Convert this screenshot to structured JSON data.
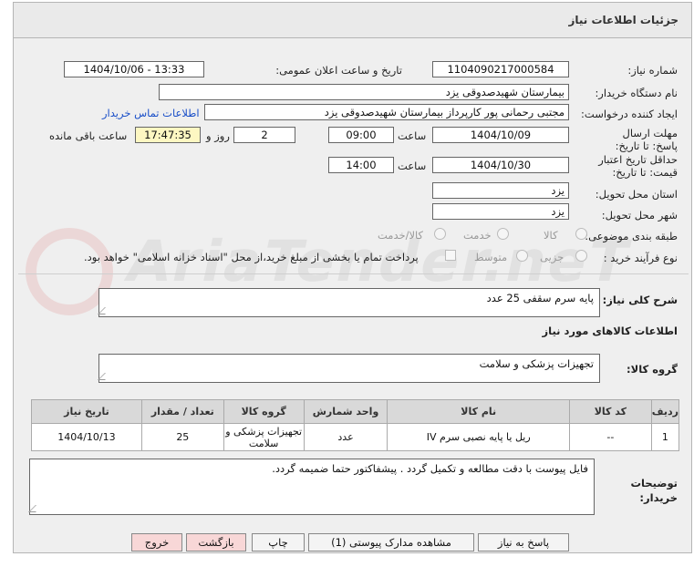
{
  "header": {
    "title": "جزئیات اطلاعات نیاز"
  },
  "fields": {
    "need_number_label": "شماره نیاز:",
    "need_number": "1104090217000584",
    "announce_label": "تاریخ و ساعت اعلان عمومی:",
    "announce_value": "1404/10/06 - 13:33",
    "buyer_label": "نام دستگاه خریدار:",
    "buyer_value": "بیمارستان شهیدصدوقی یزد",
    "creator_label": "ایجاد کننده درخواست:",
    "creator_value": "مجتبی رحمانی پور کارپرداز بیمارستان شهیدصدوقی یزد",
    "contact_link": "اطلاعات تماس خریدار",
    "deadline_label": "مهلت ارسال پاسخ: تا تاریخ:",
    "deadline_date": "1404/10/09",
    "time_label": "ساعت",
    "deadline_time": "09:00",
    "days_value": "2",
    "days_label": "روز و",
    "remaining_time": "17:47:35",
    "remaining_label": "ساعت باقی مانده",
    "validity_label": "حداقل تاریخ اعتبار قیمت: تا تاریخ:",
    "validity_date": "1404/10/30",
    "validity_time": "14:00",
    "province_label": "استان محل تحویل:",
    "province_value": "یزد",
    "city_label": "شهر محل تحویل:",
    "city_value": "یزد",
    "category_label": "طبقه بندی موضوعی:",
    "category_options": [
      "کالا",
      "خدمت",
      "کالا/خدمت"
    ],
    "process_label": "نوع فرآیند خرید :",
    "process_options": [
      "جزیی",
      "متوسط"
    ],
    "payment_note": "پرداخت تمام یا بخشی از مبلغ خرید،از محل \"اسناد خزانه اسلامی\" خواهد بود."
  },
  "description": {
    "label": "شرح کلی نیاز:",
    "value": "پایه سرم سقفی 25 عدد"
  },
  "goods_section_title": "اطلاعات کالاهای مورد نیاز",
  "goods_group": {
    "label": "گروه کالا:",
    "value": "تجهیزات پزشکی و سلامت"
  },
  "table": {
    "headers": [
      "ردیف",
      "کد کالا",
      "نام کالا",
      "واحد شمارش",
      "گروه کالا",
      "تعداد / مقدار",
      "تاریخ نیاز"
    ],
    "rows": [
      [
        "1",
        "--",
        "ریل یا پایه نصبی سرم IV",
        "عدد",
        "تجهیزات پزشکی و سلامت",
        "25",
        "1404/10/13"
      ]
    ]
  },
  "buyer_notes": {
    "label": "توضیحات خریدار:",
    "value": "فایل پیوست با دقت مطالعه و تکمیل گردد . پیشفاکتور حتما ضمیمه گردد."
  },
  "buttons": {
    "reply": "پاسخ به نیاز",
    "attachments": "مشاهده مدارک پیوستی (1)",
    "print": "چاپ",
    "back": "بازگشت",
    "exit": "خروج"
  },
  "watermark_text": "AriaTender.neT"
}
